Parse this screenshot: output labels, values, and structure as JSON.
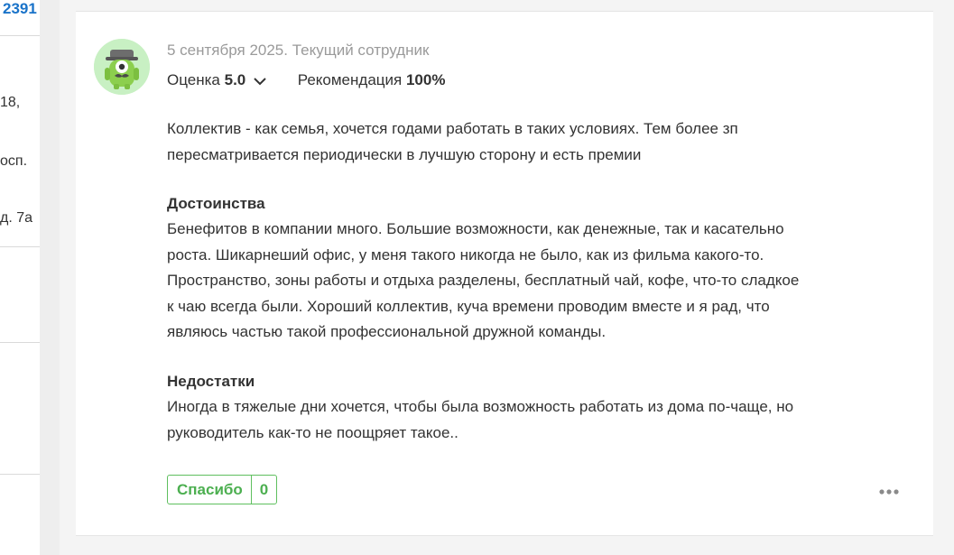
{
  "left_column": {
    "number": "2391",
    "fragments": [
      "18,",
      "осп.",
      "д. 7а"
    ]
  },
  "review": {
    "meta": "5 сентября 2025. Текущий сотрудник",
    "rating_label": "Оценка",
    "rating_value": "5.0",
    "recommend_label": "Рекомендация",
    "recommend_value": "100%",
    "summary": "Коллектив - как семья, хочется годами работать в таких условиях. Тем более зп пересматривается периодически в лучшую сторону и есть премии",
    "pros_title": "Достоинства",
    "pros_text": "Бенефитов в компании много. Большие возможности, как денежные, так и касательно роста. Шикарнеший офис, у меня такого никогда не было, как из фильма какого-то. Пространство, зоны работы и отдыха разделены, бесплатный чай, кофе, что-то сладкое к чаю всегда были. Хороший коллектив, куча времени проводим вместе и я рад, что являюсь частью такой профессиональной дружной команды.",
    "cons_title": "Недостатки",
    "cons_text": "Иногда в тяжелые дни хочется, чтобы была возможность работать из дома по-чаще, но руководитель как-то не поощряет такое..",
    "thanks_label": "Спасибо",
    "thanks_count": "0"
  },
  "colors": {
    "accent_green": "#4caf50",
    "link_blue": "#1a73c9"
  },
  "icons": [
    "avatar-monster-icon",
    "chevron-down-icon",
    "more-dots-icon"
  ]
}
